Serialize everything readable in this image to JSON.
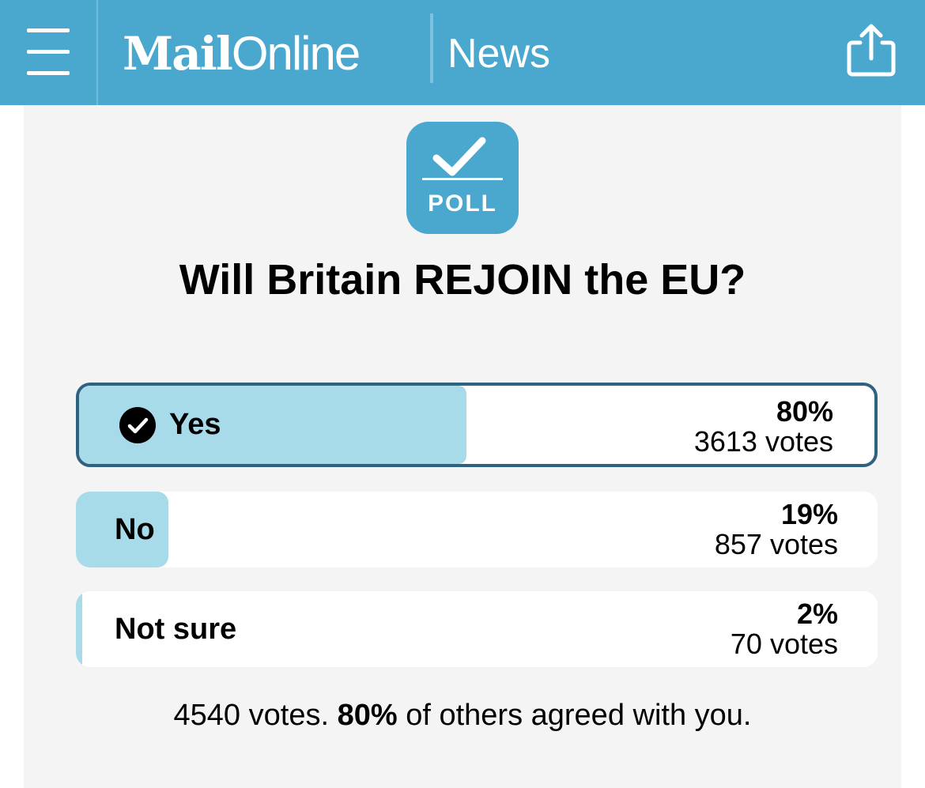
{
  "header": {
    "logo_bold": "Mail",
    "logo_light": "Online",
    "section": "News",
    "menu_icon": "hamburger-menu-icon",
    "share_icon": "share-icon",
    "background_color": "#4aa7ce"
  },
  "poll": {
    "badge_label": "POLL",
    "badge_icon": "poll-checkmark-icon",
    "question": "Will Britain REJOIN the EU?",
    "options": [
      {
        "label": "Yes",
        "percent_text": "80%",
        "votes_text": "3613 votes",
        "fraction": 0.8,
        "selected": true
      },
      {
        "label": "No",
        "percent_text": "19%",
        "votes_text": "857 votes",
        "fraction": 0.19,
        "selected": false
      },
      {
        "label": "Not sure",
        "percent_text": "2%",
        "votes_text": "70 votes",
        "fraction": 0.02,
        "selected": false
      }
    ],
    "summary": {
      "total_text": "4540 votes.",
      "agree_percent": "80%",
      "agree_text": "of others agreed with you."
    },
    "fill_color": "#a8dbea",
    "selected_border_color": "#2f6180"
  }
}
